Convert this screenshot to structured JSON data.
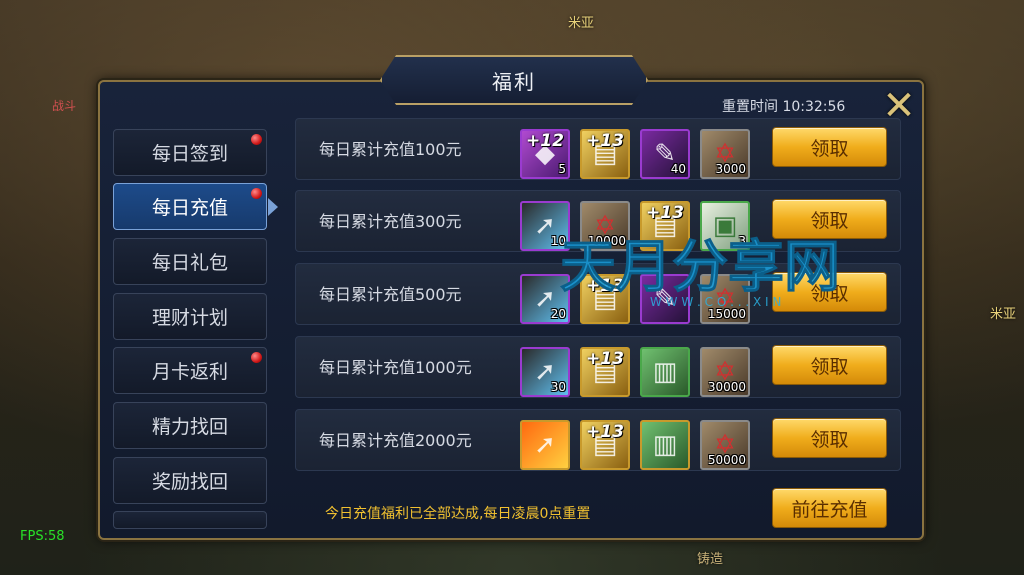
{
  "background": {
    "npc_top": "米亚",
    "npc_right": "米亚",
    "left_tag": "战斗",
    "bottom_label": "铸造"
  },
  "fps": "FPS:58",
  "window": {
    "title": "福利",
    "reset_time": "重置时间 10:32:56"
  },
  "sidebar": {
    "items": [
      {
        "label": "每日签到",
        "badge": true,
        "active": false
      },
      {
        "label": "每日充值",
        "badge": true,
        "active": true
      },
      {
        "label": "每日礼包",
        "badge": false,
        "active": false
      },
      {
        "label": "理财计划",
        "badge": false,
        "active": false
      },
      {
        "label": "月卡返利",
        "badge": true,
        "active": false
      },
      {
        "label": "精力找回",
        "badge": false,
        "active": false
      },
      {
        "label": "奖励找回",
        "badge": false,
        "active": false
      }
    ]
  },
  "rewards": [
    {
      "label": "每日累计充值100元",
      "button": "领取",
      "items": [
        {
          "plus": "+12",
          "qty": "5"
        },
        {
          "plus": "+13",
          "qty": ""
        },
        {
          "plus": "",
          "qty": "40"
        },
        {
          "plus": "",
          "qty": "3000"
        }
      ]
    },
    {
      "label": "每日累计充值300元",
      "button": "领取",
      "items": [
        {
          "plus": "",
          "qty": "10"
        },
        {
          "plus": "",
          "qty": "10000"
        },
        {
          "plus": "+13",
          "qty": ""
        },
        {
          "plus": "",
          "qty": "3"
        }
      ]
    },
    {
      "label": "每日累计充值500元",
      "button": "领取",
      "items": [
        {
          "plus": "",
          "qty": "20"
        },
        {
          "plus": "+13",
          "qty": ""
        },
        {
          "plus": "",
          "qty": ""
        },
        {
          "plus": "",
          "qty": "15000"
        }
      ]
    },
    {
      "label": "每日累计充值1000元",
      "button": "领取",
      "items": [
        {
          "plus": "",
          "qty": "30"
        },
        {
          "plus": "+13",
          "qty": ""
        },
        {
          "plus": "",
          "qty": ""
        },
        {
          "plus": "",
          "qty": "30000"
        }
      ]
    },
    {
      "label": "每日累计充值2000元",
      "button": "领取",
      "items": [
        {
          "plus": "",
          "qty": ""
        },
        {
          "plus": "+13",
          "qty": ""
        },
        {
          "plus": "",
          "qty": ""
        },
        {
          "plus": "",
          "qty": "50000"
        }
      ]
    }
  ],
  "footer": {
    "notice": "今日充值福利已全部达成,每日凌晨0点重置",
    "goto_button": "前往充值"
  },
  "watermark": {
    "text": "天月分享网",
    "sub": "W W W . C O . . . X I N"
  },
  "colors": {
    "accent_gold": "#f0ad1c",
    "badge_red": "#d01818",
    "active_tab": "#1d4b8a",
    "notice": "#f0c030"
  }
}
